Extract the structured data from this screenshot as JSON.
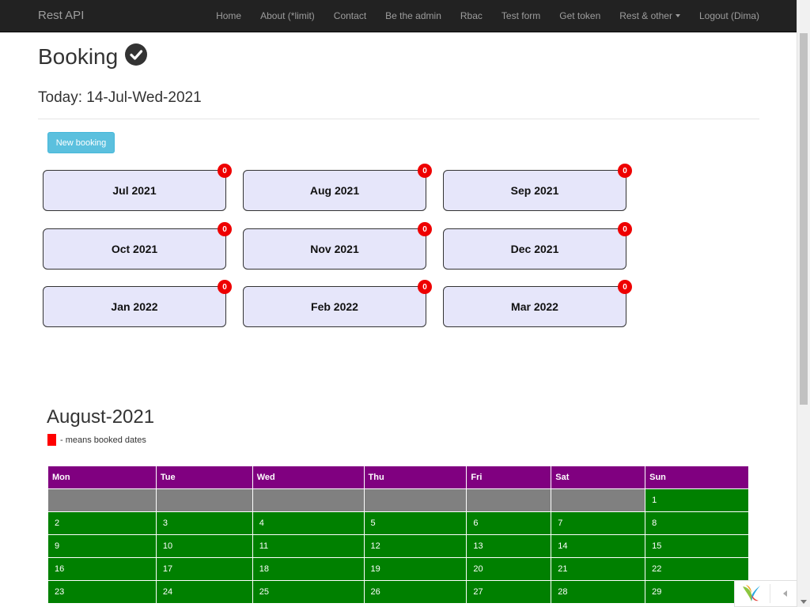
{
  "navbar": {
    "brand": "Rest API",
    "items": [
      {
        "label": "Home"
      },
      {
        "label": "About (*limit)"
      },
      {
        "label": "Contact"
      },
      {
        "label": "Be the admin"
      },
      {
        "label": "Rbac"
      },
      {
        "label": "Test form"
      },
      {
        "label": "Get token"
      },
      {
        "label": "Rest & other"
      },
      {
        "label": "Logout (Dima)"
      }
    ]
  },
  "page": {
    "title": "Booking",
    "today": "Today: 14-Jul-Wed-2021",
    "new_booking_label": "New booking"
  },
  "months": [
    {
      "label": "Jul 2021",
      "count": "0"
    },
    {
      "label": "Aug 2021",
      "count": "0"
    },
    {
      "label": "Sep 2021",
      "count": "0"
    },
    {
      "label": "Oct 2021",
      "count": "0"
    },
    {
      "label": "Nov 2021",
      "count": "0"
    },
    {
      "label": "Dec 2021",
      "count": "0"
    },
    {
      "label": "Jan 2022",
      "count": "0"
    },
    {
      "label": "Feb 2022",
      "count": "0"
    },
    {
      "label": "Mar 2022",
      "count": "0"
    }
  ],
  "calendar": {
    "title": "August-2021",
    "legend_text": "- means booked dates",
    "headers": [
      "Mon",
      "Tue",
      "Wed",
      "Thu",
      "Fri",
      "Sat",
      "Sun"
    ],
    "rows": [
      [
        "",
        "",
        "",
        "",
        "",
        "",
        "1"
      ],
      [
        "2",
        "3",
        "4",
        "5",
        "6",
        "7",
        "8"
      ],
      [
        "9",
        "10",
        "11",
        "12",
        "13",
        "14",
        "15"
      ],
      [
        "16",
        "17",
        "18",
        "19",
        "20",
        "21",
        "22"
      ],
      [
        "23",
        "24",
        "25",
        "26",
        "27",
        "28",
        "29"
      ]
    ]
  },
  "colors": {
    "header_bg": "#800080",
    "available": "#008000",
    "empty": "#808080",
    "booked": "#ff0000",
    "month_card": "#e6e6fa",
    "badge": "#ee0000"
  }
}
